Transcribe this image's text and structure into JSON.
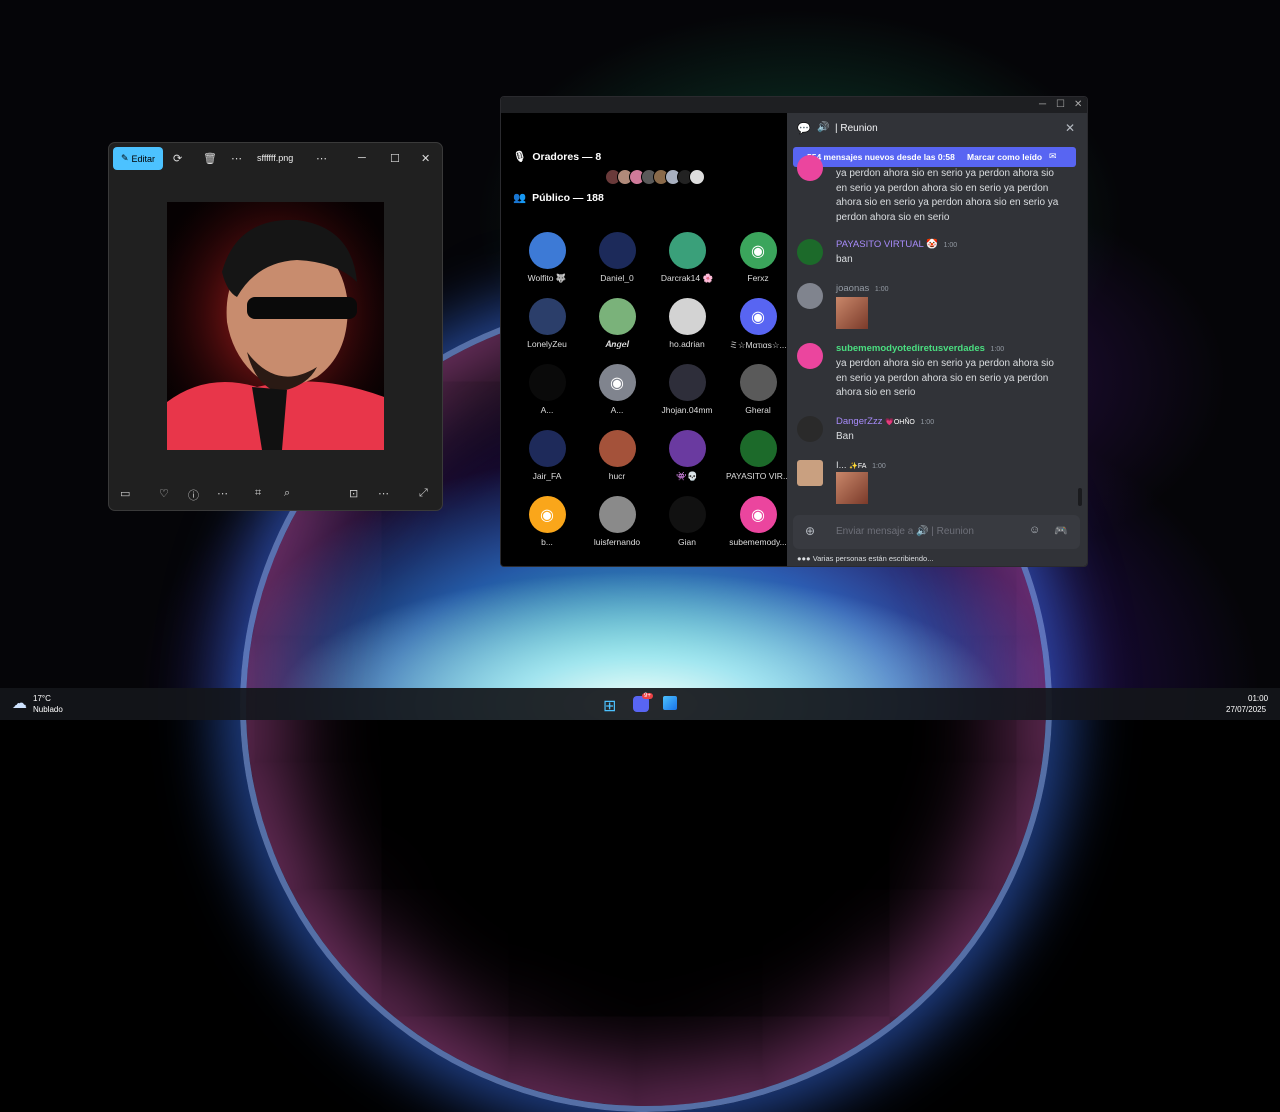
{
  "photos": {
    "edit_label": "Editar",
    "filename": "sffffff.png",
    "icons": [
      "rotate-icon",
      "delete-icon",
      "more-icon",
      "more-icon",
      "minimize-icon",
      "maximize-icon",
      "close-icon"
    ],
    "bottom_icons": [
      "filmstrip-icon",
      "favorite-icon",
      "info-icon",
      "more-icon",
      "crop-icon",
      "visual-search-icon",
      "fit-icon",
      "more-icon",
      "expand-icon"
    ]
  },
  "discord": {
    "speakers_label": "Oradores — 8",
    "audience_label": "Público — 188",
    "audience": [
      {
        "name": "Wolfito 🐺",
        "color": "#3d7ad6"
      },
      {
        "name": "Daniel_0",
        "color": "#1c2a5a"
      },
      {
        "name": "Darcrak14 🌸",
        "color": "#3aa07a"
      },
      {
        "name": "Ferxz",
        "color": "#3ba55c",
        "discord": true
      },
      {
        "name": "LonelyZeu",
        "color": "#2b3e6a"
      },
      {
        "name": "𝑨𝒏𝒈𝒆𝒍",
        "color": "#7ab27a"
      },
      {
        "name": "ho.adrian",
        "color": "#d3d3d3"
      },
      {
        "name": "ミ☆Mατιαs☆...",
        "color": "#5865f2",
        "discord": true
      },
      {
        "name": "A...",
        "color": "#0a0a0a"
      },
      {
        "name": "A...",
        "color": "#80848e",
        "discord": true
      },
      {
        "name": "Jhojan.04mm",
        "color": "#2e2e3a"
      },
      {
        "name": "Gheral",
        "color": "#5a5a5a"
      },
      {
        "name": "Jair_FA",
        "color": "#1e2a5a"
      },
      {
        "name": "hucr",
        "color": "#a4523a"
      },
      {
        "name": "👾💀",
        "color": "#6a3aa0"
      },
      {
        "name": "PAYASITO VIR...",
        "color": "#1c6a2a"
      },
      {
        "name": "b...",
        "color": "#faa61a",
        "discord": true
      },
      {
        "name": "luisfernando",
        "color": "#8a8a8a"
      },
      {
        "name": "Gian",
        "color": "#111111"
      },
      {
        "name": "subememody...",
        "color": "#eb459e",
        "discord": true
      }
    ],
    "chat": {
      "channel": "| Reunion",
      "new_messages": "554 mensajes nuevos desde las 0:58",
      "mark_read": "Marcar como leído",
      "messages": [
        {
          "author": "",
          "time": "",
          "color": "#eb459e",
          "text": "ya perdon ahora sio en serio ya perdon ahora sio en serio ya perdon ahora sio en serio ya perdon ahora sio en serio ya perdon ahora sio en serio ya perdon ahora sio en serio"
        },
        {
          "author": "PAYASITO VIRTUAL 🤡",
          "time": "1:00",
          "color": "#1c6a2a",
          "name_color": "#a78bfa",
          "text": "ban"
        },
        {
          "author": "joaonas",
          "time": "1:00",
          "color": "#80848e",
          "name_color": "#949ba4",
          "text": ""
        },
        {
          "author": "subememodyotediretusverdades",
          "time": "1:00",
          "color": "#eb459e",
          "name_color": "#4ade80",
          "text": "ya perdon ahora sio en serio ya perdon ahora sio en serio ya perdon ahora sio en serio ya perdon ahora sio en serio"
        },
        {
          "author": "DangerZzz",
          "badge": "💗OHÑO",
          "time": "1:00",
          "color": "#2a2a2a",
          "name_color": "#a78bfa",
          "text": "Ban"
        },
        {
          "author": "I...",
          "badge": "✨FA",
          "time": "1:00",
          "color": "#c9a080",
          "name_color": "#dbdee1",
          "text": ""
        }
      ],
      "composer_placeholder": "Enviar mensaje a 🔊 | Reunion",
      "typing": "Varias personas están escribiendo..."
    }
  },
  "taskbar": {
    "temp": "17°C",
    "weather": "Nublado",
    "discord_badge": "9+",
    "time": "01:00",
    "date": "27/07/2025"
  }
}
